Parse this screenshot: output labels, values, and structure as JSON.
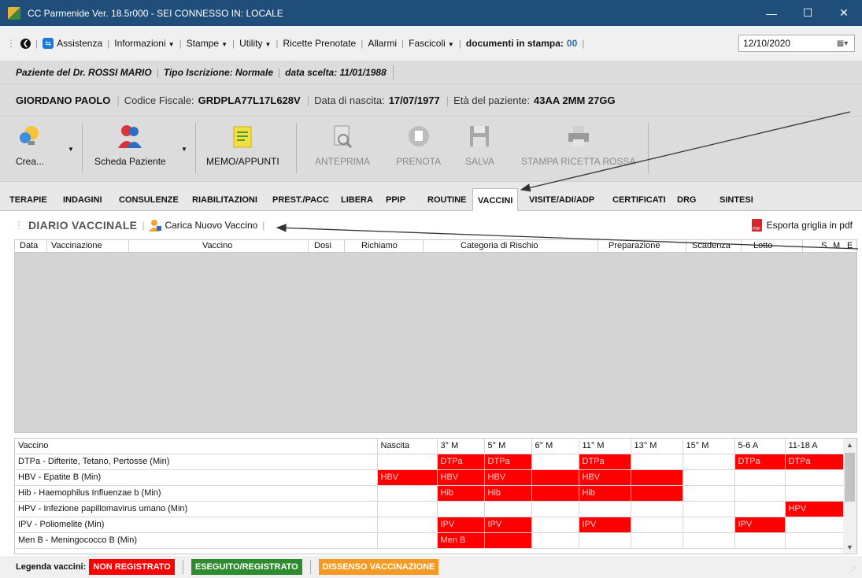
{
  "window": {
    "title": "CC Parmenide Ver. 18.5r000 - SEI CONNESSO IN: LOCALE",
    "minimize": "—",
    "maximize": "☐",
    "close": "✕"
  },
  "menubar": {
    "items": [
      "Assistenza",
      "Informazioni",
      "Stampe",
      "Utility",
      "Ricette Prenotate",
      "Allarmi",
      "Fascicoli"
    ],
    "print_label": "documenti in stampa:",
    "print_count": "00",
    "date": "12/10/2020"
  },
  "patient_line": {
    "doctor": "Paziente del Dr. ROSSI MARIO",
    "iscrizione": "Tipo Iscrizione: Normale",
    "data_scelta": "data scelta: 11/01/1988"
  },
  "patient_info": {
    "name": "GIORDANO PAOLO",
    "cf_label": "Codice Fiscale:",
    "cf_value": "GRDPLA77L17L628V",
    "birth_label": "Data di nascita:",
    "birth_value": "17/07/1977",
    "age_label": "Età del paziente:",
    "age_value": "43AA 2MM 27GG"
  },
  "toolbar": {
    "crea": "Crea...",
    "scheda": "Scheda Paziente",
    "memo": "MEMO/APPUNTI",
    "anteprima": "ANTEPRIMA",
    "prenota": "PRENOTA",
    "salva": "SALVA",
    "stampa": "STAMPA RICETTA ROSSA"
  },
  "tabs": [
    "TERAPIE",
    "INDAGINI",
    "CONSULENZE",
    "RIABILITAZIONI",
    "PREST./PACC",
    "LIBERA",
    "PPIP",
    "ROUTINE",
    "VACCINI",
    "VISITE/ADI/ADP",
    "CERTIFICATI",
    "DRG",
    "SINTESI"
  ],
  "diario": {
    "title": "DIARIO VACCINALE",
    "load_button": "Carica Nuovo Vaccino",
    "pdf_button": "Esporta griglia in pdf",
    "columns": [
      "Data",
      "Vaccinazione",
      "Vaccino",
      "Dosi",
      "Richiamo",
      "Categoria di Rischio",
      "Preparazione",
      "Scadenza",
      "Lotto",
      "S",
      "M",
      "E"
    ]
  },
  "schedule": {
    "headers": [
      "Vaccino",
      "Nascita",
      "3° M",
      "5° M",
      "6° M",
      "11° M",
      "13° M",
      "15° M",
      "5-6 A",
      "11-18 A"
    ],
    "rows": [
      {
        "name": "DTPa - Difterite, Tetano, Pertosse (Min)",
        "cells": [
          "",
          "DTPa",
          "DTPa",
          "",
          "DTPa",
          "",
          "",
          "DTPa",
          "DTPa"
        ],
        "red": [
          0,
          1,
          1,
          0,
          1,
          0,
          0,
          1,
          1
        ]
      },
      {
        "name": "HBV - Epatite B (Min)",
        "cells": [
          "HBV",
          "HBV",
          "HBV",
          "",
          "HBV",
          "",
          "",
          "",
          ""
        ],
        "red": [
          1,
          1,
          1,
          1,
          1,
          1,
          0,
          0,
          0
        ]
      },
      {
        "name": "Hib - Haemophilus Influenzae b (Min)",
        "cells": [
          "",
          "Hib",
          "Hib",
          "",
          "Hib",
          "",
          "",
          "",
          ""
        ],
        "red": [
          0,
          1,
          1,
          1,
          1,
          1,
          0,
          0,
          0
        ]
      },
      {
        "name": "HPV - Infezione papillomavirus umano (Min)",
        "cells": [
          "",
          "",
          "",
          "",
          "",
          "",
          "",
          "",
          "HPV"
        ],
        "red": [
          0,
          0,
          0,
          0,
          0,
          0,
          0,
          0,
          1
        ]
      },
      {
        "name": "IPV - Poliomelite (Min)",
        "cells": [
          "",
          "IPV",
          "IPV",
          "",
          "IPV",
          "",
          "",
          "IPV",
          ""
        ],
        "red": [
          0,
          1,
          1,
          0,
          1,
          0,
          0,
          1,
          0
        ]
      },
      {
        "name": "Men B - Meningococco B (Min)",
        "cells": [
          "",
          "Men B",
          "",
          "",
          "",
          "",
          "",
          "",
          ""
        ],
        "red": [
          0,
          1,
          1,
          0,
          0,
          0,
          0,
          0,
          0
        ]
      }
    ]
  },
  "legend": {
    "label": "Legenda vaccini:",
    "items": [
      {
        "text": "NON REGISTRATO",
        "color": "#ff0000"
      },
      {
        "text": "ESEGUITO/REGISTRATO",
        "color": "#2e8b2e"
      },
      {
        "text": "DISSENSO VACCINAZIONE",
        "color": "#f59a23"
      }
    ]
  }
}
